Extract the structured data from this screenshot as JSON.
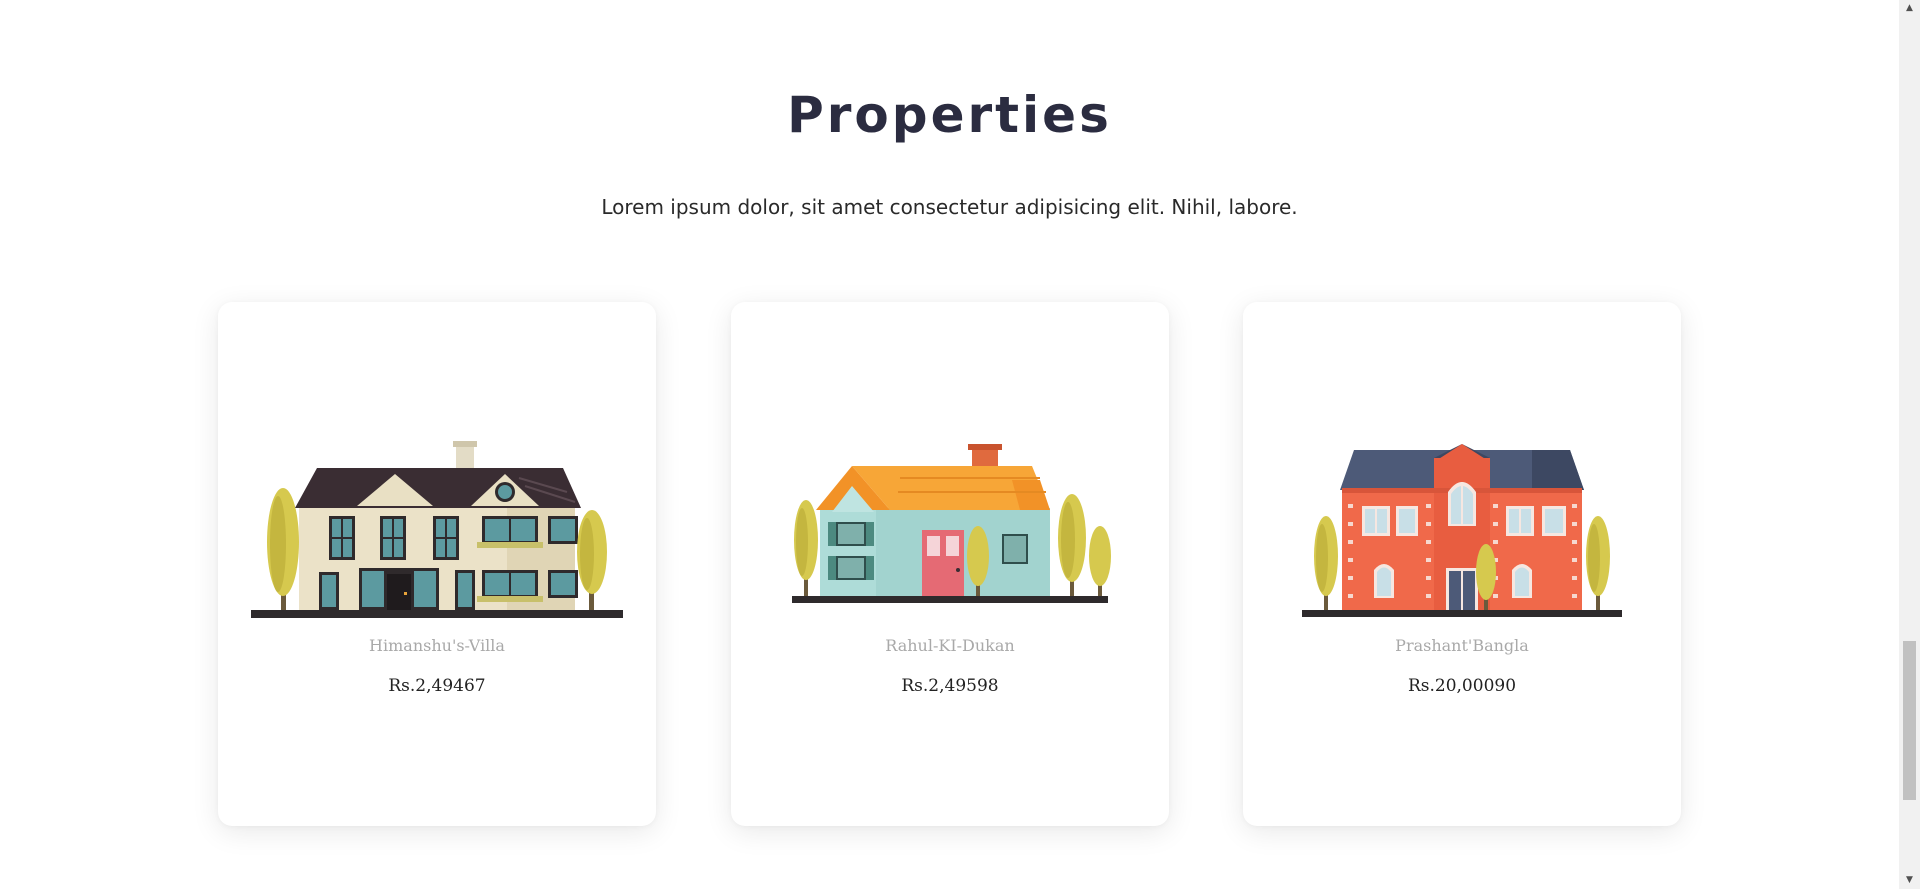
{
  "section": {
    "title": "Properties",
    "subtitle": "Lorem ipsum dolor, sit amet consectetur adipisicing elit. Nihil, labore."
  },
  "properties": [
    {
      "name": "Himanshu's-Villa",
      "price": "Rs.2,49467",
      "icon": "villa-house-icon"
    },
    {
      "name": "Rahul-KI-Dukan",
      "price": "Rs.2,49598",
      "icon": "cottage-house-icon"
    },
    {
      "name": "Prashant'Bangla",
      "price": "Rs.20,00090",
      "icon": "brick-mansion-icon"
    }
  ],
  "scrollbar": {
    "up_arrow": "▲",
    "down_arrow": "▼"
  },
  "colors": {
    "title": "#2b2c40",
    "name_text": "#a9a9a9",
    "price_text": "#222222",
    "tree": "#d6c94e",
    "roof_dark": "#3a2d33",
    "roof_orange": "#f29227",
    "brick": "#f0694a",
    "slate_roof": "#4d5a78"
  }
}
